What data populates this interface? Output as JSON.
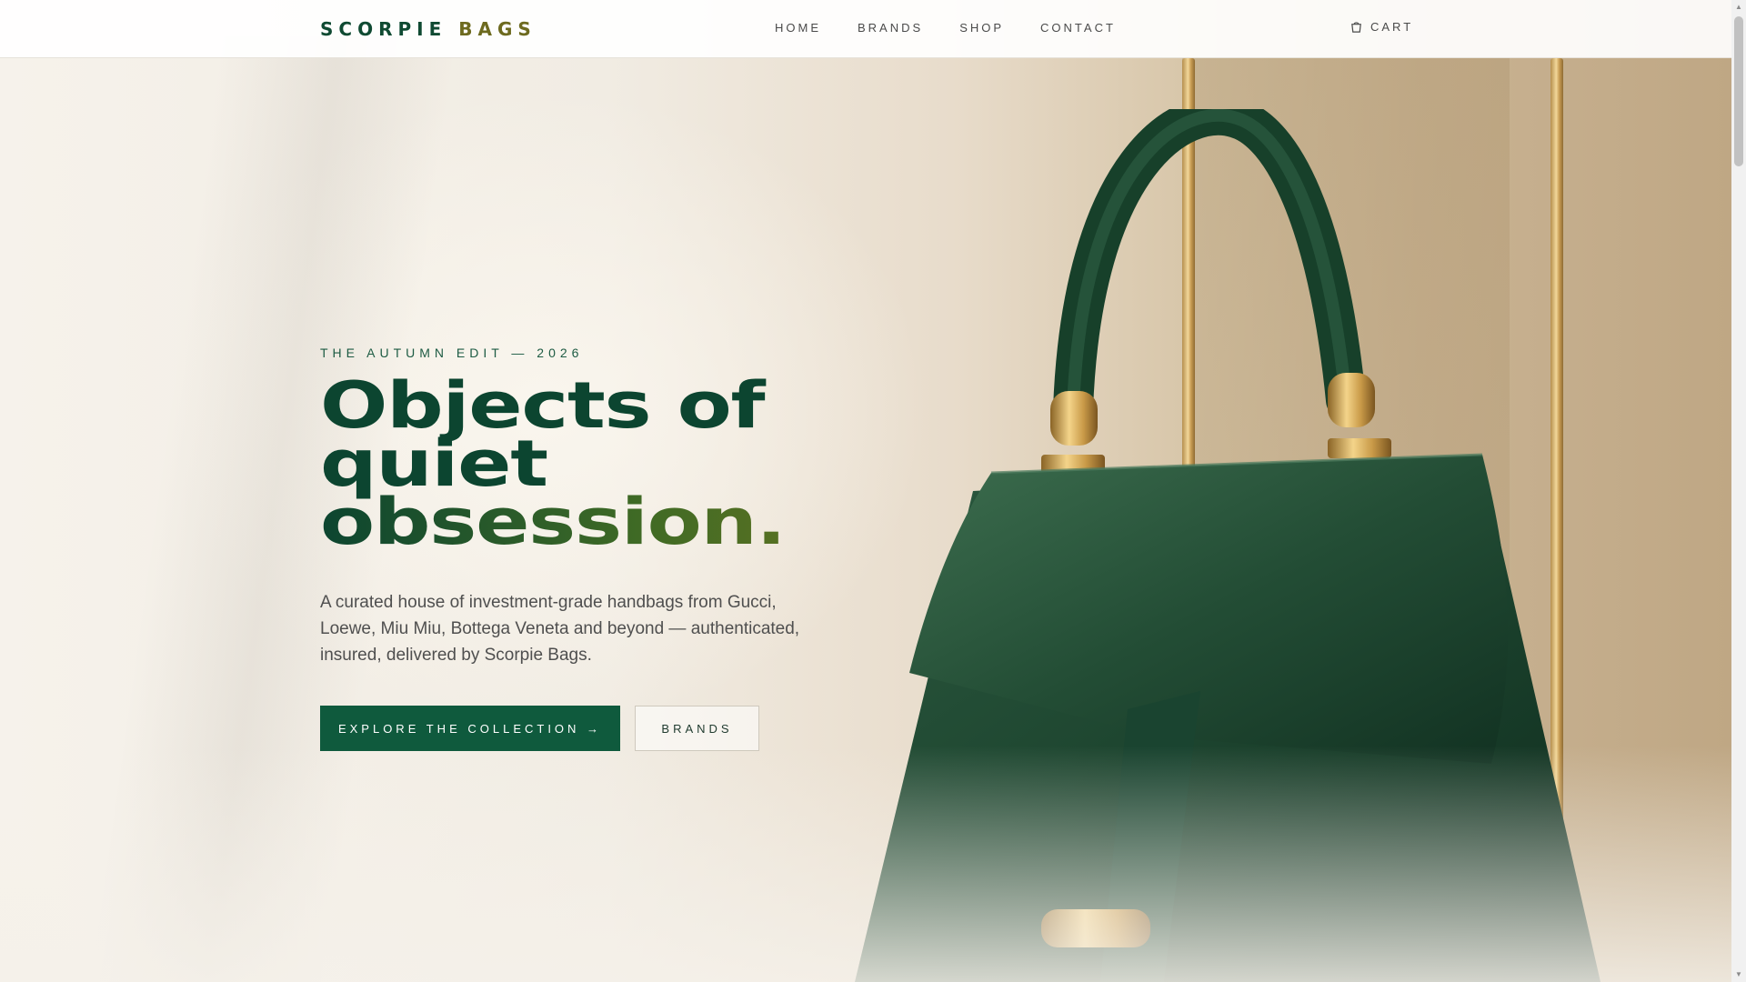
{
  "brand": {
    "name_part1": "SCORPIE",
    "name_part2": "BAGS"
  },
  "nav": {
    "links": [
      "HOME",
      "BRANDS",
      "SHOP",
      "CONTACT"
    ],
    "cart_label": "CART"
  },
  "hero": {
    "eyebrow": "THE AUTUMN EDIT — 2026",
    "headline_line1": "Objects of",
    "headline_line2": "quiet",
    "headline_line3": "obsession.",
    "lede": "A curated house of investment-grade handbags from Gucci, Loewe, Miu Miu, Bottega Veneta and beyond — authenticated, insured, delivered by Scorpie Bags.",
    "primary_cta": "EXPLORE THE COLLECTION →",
    "secondary_cta": "BRANDS"
  },
  "icons": {
    "cart": "shopping-bag-icon"
  },
  "colors": {
    "brand_green": "#0f5a3d",
    "headline_green": "#0c4530",
    "accent_olive": "#6d6a1f"
  }
}
